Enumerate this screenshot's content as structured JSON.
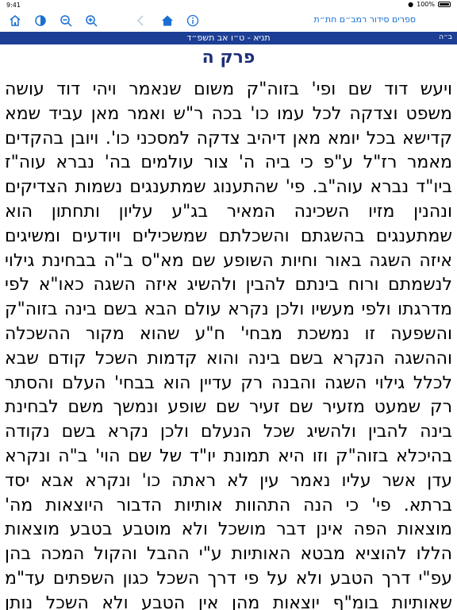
{
  "status_bar": {
    "time": "9:41",
    "battery": "100%"
  },
  "toolbar": {
    "title": "ספרים סידור רמב״ם חת״ת",
    "icons": [
      "home-icon",
      "contrast-icon",
      "zoom-out-icon",
      "zoom-in-icon",
      "back-icon",
      "home-blue-icon",
      "info-icon"
    ]
  },
  "header": {
    "title": "תניא - ט״ו אב תשפ״ד",
    "badge": "ב״ה"
  },
  "chapter_title": "פרק ה",
  "lines": [
    "ויעש דוד שם ופי' בזוה\"ק משום שנאמר ויהי דוד עושה",
    "משפט וצדקה לכל עמו כו' בכה ר\"ש ואמר מאן עביד שמא",
    "קדישא בכל יומא מאן דיהיב צדקה למסכני כו'. ויובן בהקדים",
    "מאמר רז\"ל ע\"פ כי ביה ה' צור עולמים בה' נברא עוה\"ז",
    "ביו\"ד נברא עוה\"ב. פי' שהתענוג שמתענגים נשמות הצדיקים",
    "ונהנין מזיו השכינה המאיר בג\"ע עליון ותחתון הוא",
    "שמתענגים בהשגתם והשכלתם שמשכילים ויודעים ומשיגים",
    "איזה השגה באור וחיות השופע שם מא\"ס ב\"ה בבחינת גילוי",
    "לנשמתם ורוח בינתם להבין ולהשיג איזה השגה כאו\"א לפי",
    "מדרגתו ולפי מעשיו ולכן נקרא עולם הבא בשם בינה בזוה\"ק",
    "והשפעה זו נמשכת מבחי' ח\"ע שהוא מקור ההשכלה",
    "וההשגה הנקרא בשם בינה והוא קדמות השכל קודם שבא",
    "לכלל גילוי השגה והבנה רק עדיין הוא בבחי' העלם והסתר",
    "רק שמעט מזעיר שם זעיר שם שופע ונמשך משם לבחינת",
    "בינה להבין ולהשיג שכל הנעלם ולכן נקרא בשם נקודה",
    "בהיכלא בזוה\"ק וזו היא תמונת יו\"ד של שם הוי' ב\"ה ונקרא",
    "עדן אשר עליו נאמר עין לא ראתה כו' ונקרא אבא יסד",
    "ברתא. פי' כי הנה התהוות אותיות הדבור היוצאות מה'",
    "מוצאות הפה אינן דבר מושכל ולא מוטבע בטבע מוצאות",
    "הללו להוציא מבטא האותיות ע\"י ההבל והקול המכה בהן",
    "עפ\"י דרך הטבע ולא על פי דרך השכל כגון השפתים עד\"מ",
    "שאותיות בומ\"ף יוצאות מהן אין הטבע ולא השכל נותן"
  ]
}
